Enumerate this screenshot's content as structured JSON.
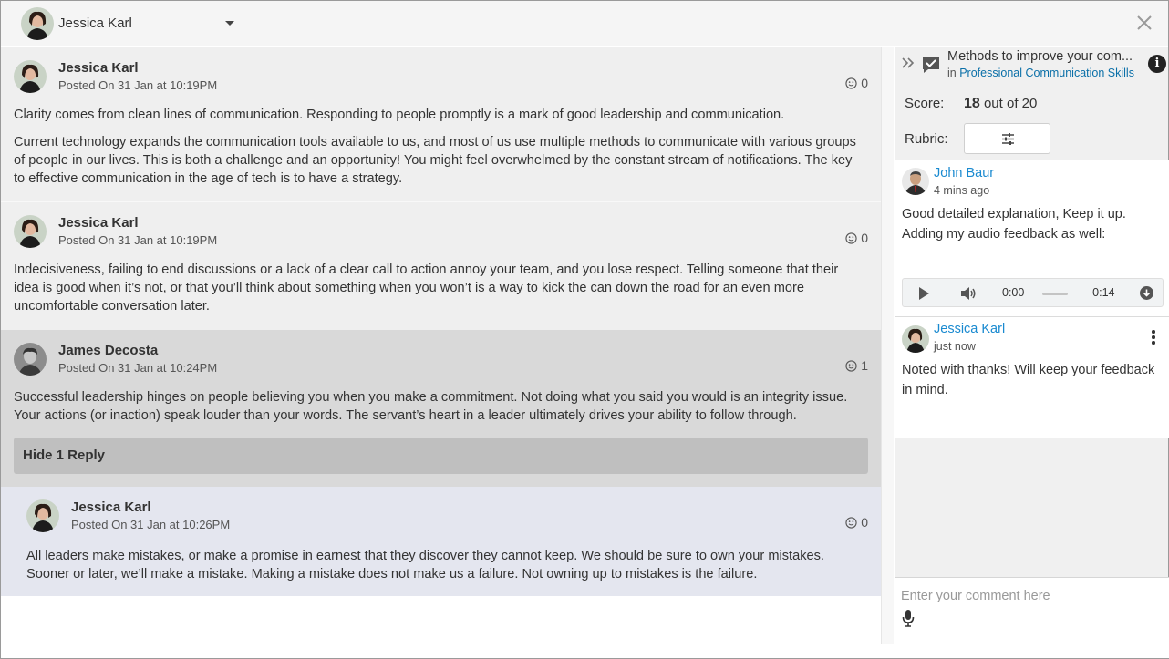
{
  "header": {
    "user_name": "Jessica Karl"
  },
  "posts": [
    {
      "author": "Jessica Karl",
      "posted": "Posted On 31 Jan at 10:19PM",
      "reactions": "0",
      "paragraphs": [
        "Clarity comes from clean lines of communication. Responding to people promptly is a mark of good leadership and communication.",
        "Current technology expands the communication tools available to us, and most of us use multiple methods to communicate with various groups of people in our lives. This is both a challenge and an opportunity! You might feel overwhelmed by the constant stream of notifications. The key to effective communication in the age of tech is to have a strategy."
      ]
    },
    {
      "author": "Jessica Karl",
      "posted": "Posted On 31 Jan at 10:19PM",
      "reactions": "0",
      "paragraphs": [
        "Indecisiveness, failing to end discussions or a lack of a clear call to action annoy your team, and you lose respect. Telling someone that their idea is good when it’s not, or that you’ll think about something when you won’t is a way to kick the can down the road for an even more uncomfortable conversation later."
      ]
    },
    {
      "author": "James Decosta",
      "posted": "Posted On 31 Jan at 10:24PM",
      "reactions": "1",
      "paragraphs": [
        "Successful leadership hinges on people believing you when you make a commitment. Not doing what you said you would is an integrity issue. Your actions (or inaction) speak louder than your words. The servant’s heart in a leader ultimately drives your ability to follow through."
      ],
      "hide_replies_label": "Hide 1 Reply"
    },
    {
      "author": "Jessica Karl",
      "posted": "Posted On 31 Jan at 10:26PM",
      "reactions": "0",
      "paragraphs": [
        "All leaders make mistakes, or make a promise in earnest that they discover they cannot keep. We should be sure to own your mistakes. Sooner or later, we’ll make a mistake. Making a mistake does not make us a failure. Not owning up to mistakes is the failure."
      ]
    }
  ],
  "panel": {
    "title": "Methods to improve your com...",
    "in_prefix": "in",
    "course": "Professional Communication Skills",
    "score_label": "Score:",
    "score_value": "18",
    "score_suffix": "out of 20",
    "rubric_label": "Rubric:",
    "comments": [
      {
        "name": "John Baur",
        "time": "4 mins ago",
        "text_lines": [
          "Good detailed explanation, Keep it up.",
          "Adding my audio feedback as well:"
        ],
        "audio": {
          "current": "0:00",
          "remaining": "-0:14"
        }
      },
      {
        "name": "Jessica Karl",
        "time": "just now",
        "text": "Noted with thanks! Will keep your feedback in mind."
      }
    ],
    "comment_placeholder": "Enter your comment here"
  },
  "colors": {
    "link": "#1a8ad0",
    "course_link": "#0a6fa8",
    "active_post_bg": "#d9d9d9",
    "reply_bg": "#e4e6ef",
    "post_bg": "#efefef"
  }
}
